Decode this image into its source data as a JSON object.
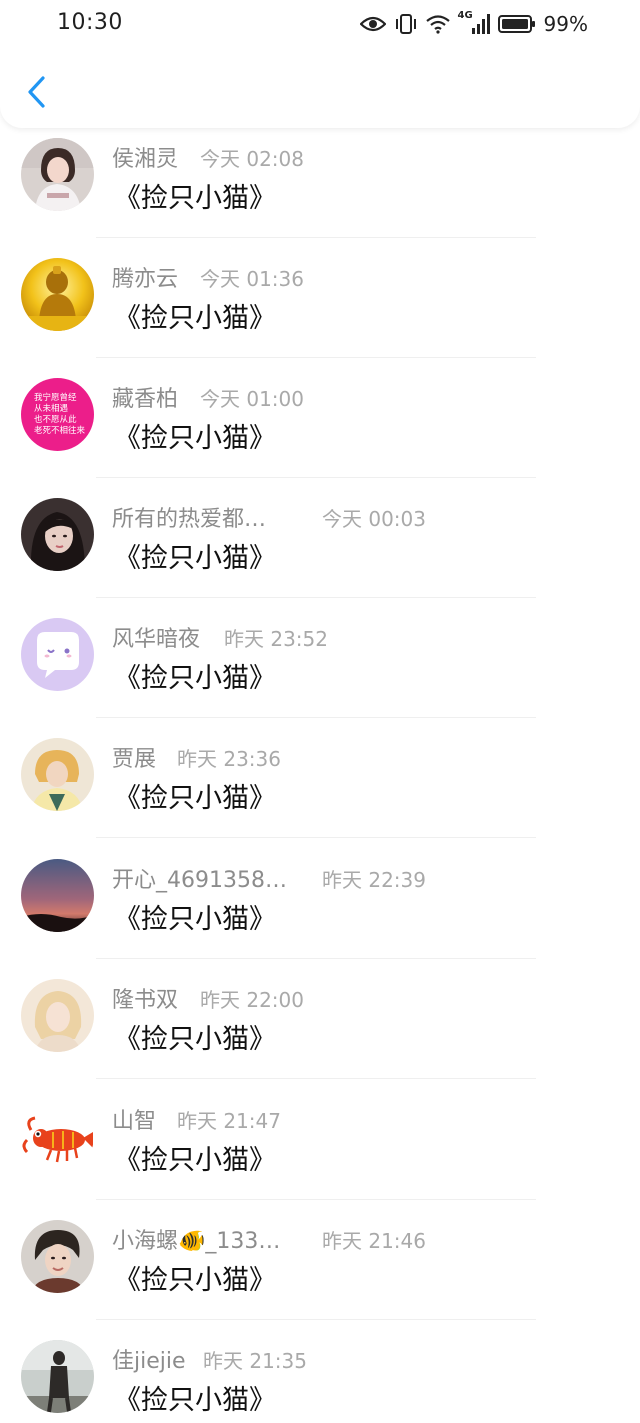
{
  "status_bar": {
    "time": "10:30",
    "network": "4G",
    "battery": "99%",
    "icons": [
      "eye-icon",
      "vibrate-icon",
      "wifi-icon",
      "signal-icon",
      "battery-icon"
    ]
  },
  "nav": {
    "back_icon": "back-chevron-icon",
    "accent": "#2196f3"
  },
  "comments": [
    {
      "name": "侯湘灵",
      "time": "今天 02:08",
      "text": "《捡只小猫》",
      "avatar": "avatar-girl-white"
    },
    {
      "name": "腾亦云",
      "time": "今天 01:36",
      "text": "《捡只小猫》",
      "avatar": "avatar-golden-buddha"
    },
    {
      "name": "藏香柏",
      "time": "今天 01:00",
      "text": "《捡只小猫》",
      "avatar": "avatar-pink-text",
      "avatar_text": [
        "我宁愿曾经",
        "从未相遇",
        "也不愿从此",
        "老死不相往来"
      ]
    },
    {
      "name": "所有的热爱都…",
      "time": "今天 00:03",
      "text": "《捡只小猫》",
      "avatar": "avatar-dark-girl"
    },
    {
      "name": "风华暗夜",
      "time": "昨天 23:52",
      "text": "《捡只小猫》",
      "avatar": "avatar-purple-chat"
    },
    {
      "name": "贾展",
      "time": "昨天 23:36",
      "text": "《捡只小猫》",
      "avatar": "avatar-blonde"
    },
    {
      "name": "开心_4691358…",
      "time": "昨天 22:39",
      "text": "《捡只小猫》",
      "avatar": "avatar-sunset"
    },
    {
      "name": "隆书双",
      "time": "昨天 22:00",
      "text": "《捡只小猫》",
      "avatar": "avatar-pale-blonde"
    },
    {
      "name": "山智",
      "time": "昨天 21:47",
      "text": "《捡只小猫》",
      "avatar": "avatar-lobster"
    },
    {
      "name": "小海螺🐠_133…",
      "time": "昨天 21:46",
      "text": "《捡只小猫》",
      "avatar": "avatar-boy"
    },
    {
      "name": "佳jiejie",
      "time": "昨天 21:35",
      "text": "《捡只小猫》",
      "avatar": "avatar-street"
    }
  ]
}
